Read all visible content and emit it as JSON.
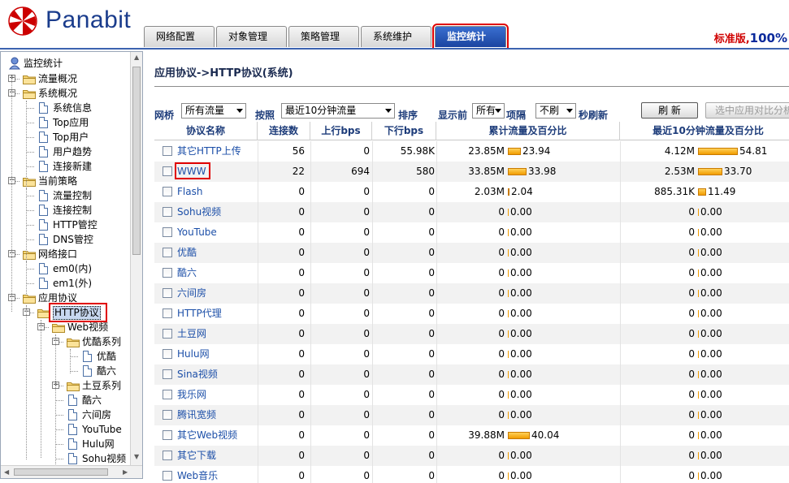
{
  "brand": "Panabit",
  "edition_label": "标准版,",
  "edition_pct": "100%",
  "colors": {
    "accent": "#1b44a0",
    "highlight": "#e00000",
    "bar": "#f19c00",
    "link": "#1c4fa8"
  },
  "tabs": [
    {
      "label": "网络配置",
      "active": false
    },
    {
      "label": "对象管理",
      "active": false
    },
    {
      "label": "策略管理",
      "active": false
    },
    {
      "label": "系统维护",
      "active": false
    },
    {
      "label": "监控统计",
      "active": true
    }
  ],
  "tree": {
    "root": "监控统计",
    "items": [
      {
        "label": "流量概况"
      },
      {
        "label": "系统概况"
      },
      {
        "label": "系统信息"
      },
      {
        "label": "Top应用"
      },
      {
        "label": "Top用户"
      },
      {
        "label": "用户趋势"
      },
      {
        "label": "连接新建"
      },
      {
        "label": "当前策略"
      },
      {
        "label": "流量控制"
      },
      {
        "label": "连接控制"
      },
      {
        "label": "HTTP管控"
      },
      {
        "label": "DNS管控"
      },
      {
        "label": "网络接口"
      },
      {
        "label": "em0(内)"
      },
      {
        "label": "em1(外)"
      },
      {
        "label": "应用协议"
      },
      {
        "label": "HTTP协议"
      },
      {
        "label": "Web视频"
      },
      {
        "label": "优酷系列"
      },
      {
        "label": "优酷"
      },
      {
        "label": "酷六"
      },
      {
        "label": "土豆系列"
      },
      {
        "label": "酷六"
      },
      {
        "label": "六间房"
      },
      {
        "label": "YouTube"
      },
      {
        "label": "Hulu网"
      },
      {
        "label": "Sohu视频"
      }
    ]
  },
  "page": {
    "title": "应用协议->HTTP协议(系统)"
  },
  "toolbar": {
    "bridge_label": "网桥",
    "bridge_value": "所有流量",
    "by_label": "按照",
    "by_value": "最近10分钟流量",
    "sort_label": "排序",
    "show_label": "显示前",
    "show_value": "所有",
    "items_label": "项隔",
    "refresh_value": "不刷",
    "refresh_suffix": "秒刷新",
    "refresh_button": "刷 新",
    "compare_button": "选中应用对比分析"
  },
  "table": {
    "headers": [
      "协议名称",
      "连接数",
      "上行bps",
      "下行bps",
      "累计流量及百分比",
      "最近10分钟流量及百分比"
    ],
    "rows": [
      {
        "name": "其它HTTP上传",
        "conns": "56",
        "up": "0",
        "down": "55.98K",
        "total": "23.85M",
        "total_pct": "23.94",
        "recent": "4.12M",
        "recent_pct": "54.81"
      },
      {
        "name": "WWW",
        "conns": "22",
        "up": "694",
        "down": "580",
        "total": "33.85M",
        "total_pct": "33.98",
        "recent": "2.53M",
        "recent_pct": "33.70"
      },
      {
        "name": "Flash",
        "conns": "0",
        "up": "0",
        "down": "0",
        "total": "2.03M",
        "total_pct": "2.04",
        "recent": "885.31K",
        "recent_pct": "11.49"
      },
      {
        "name": "Sohu视频",
        "conns": "0",
        "up": "0",
        "down": "0",
        "total": "0",
        "total_pct": "0.00",
        "recent": "0",
        "recent_pct": "0.00"
      },
      {
        "name": "YouTube",
        "conns": "0",
        "up": "0",
        "down": "0",
        "total": "0",
        "total_pct": "0.00",
        "recent": "0",
        "recent_pct": "0.00"
      },
      {
        "name": "优酷",
        "conns": "0",
        "up": "0",
        "down": "0",
        "total": "0",
        "total_pct": "0.00",
        "recent": "0",
        "recent_pct": "0.00"
      },
      {
        "name": "酷六",
        "conns": "0",
        "up": "0",
        "down": "0",
        "total": "0",
        "total_pct": "0.00",
        "recent": "0",
        "recent_pct": "0.00"
      },
      {
        "name": "六间房",
        "conns": "0",
        "up": "0",
        "down": "0",
        "total": "0",
        "total_pct": "0.00",
        "recent": "0",
        "recent_pct": "0.00"
      },
      {
        "name": "HTTP代理",
        "conns": "0",
        "up": "0",
        "down": "0",
        "total": "0",
        "total_pct": "0.00",
        "recent": "0",
        "recent_pct": "0.00"
      },
      {
        "name": "土豆网",
        "conns": "0",
        "up": "0",
        "down": "0",
        "total": "0",
        "total_pct": "0.00",
        "recent": "0",
        "recent_pct": "0.00"
      },
      {
        "name": "Hulu网",
        "conns": "0",
        "up": "0",
        "down": "0",
        "total": "0",
        "total_pct": "0.00",
        "recent": "0",
        "recent_pct": "0.00"
      },
      {
        "name": "Sina视频",
        "conns": "0",
        "up": "0",
        "down": "0",
        "total": "0",
        "total_pct": "0.00",
        "recent": "0",
        "recent_pct": "0.00"
      },
      {
        "name": "我乐网",
        "conns": "0",
        "up": "0",
        "down": "0",
        "total": "0",
        "total_pct": "0.00",
        "recent": "0",
        "recent_pct": "0.00"
      },
      {
        "name": "腾讯宽频",
        "conns": "0",
        "up": "0",
        "down": "0",
        "total": "0",
        "total_pct": "0.00",
        "recent": "0",
        "recent_pct": "0.00"
      },
      {
        "name": "其它Web视频",
        "conns": "0",
        "up": "0",
        "down": "0",
        "total": "39.88M",
        "total_pct": "40.04",
        "recent": "0",
        "recent_pct": "0.00"
      },
      {
        "name": "其它下载",
        "conns": "0",
        "up": "0",
        "down": "0",
        "total": "0",
        "total_pct": "0.00",
        "recent": "0",
        "recent_pct": "0.00"
      },
      {
        "name": "Web音乐",
        "conns": "0",
        "up": "0",
        "down": "0",
        "total": "0",
        "total_pct": "0.00",
        "recent": "0",
        "recent_pct": "0.00"
      }
    ]
  }
}
